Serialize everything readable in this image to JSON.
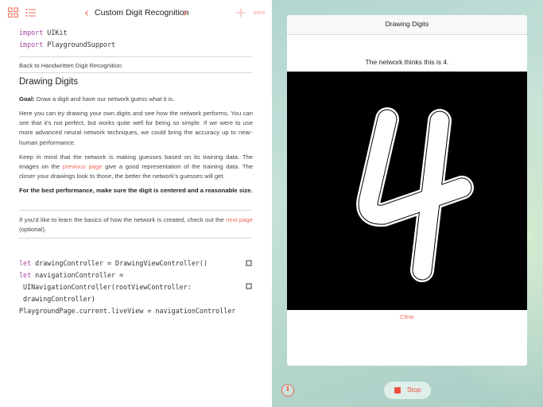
{
  "toolbar": {
    "title": "Custom Digit Recognition",
    "prev_chevron": "‹",
    "next_chevron": "›",
    "icons": [
      "grid-icon",
      "list-icon",
      "add-icon",
      "more-icon"
    ]
  },
  "code_top": [
    {
      "keyword": "import",
      "rest": " UIKit"
    },
    {
      "keyword": "import",
      "rest": " PlaygroundSupport"
    }
  ],
  "back_link": "Back to Handwritten Digit Recognition",
  "heading": "Drawing Digits",
  "goal": {
    "label": "Goal:",
    "text": " Draw a digit and have our network guess what it is."
  },
  "para1": "Here you can try drawing your own digits and see how the network performs. You can see that it's not perfect, but works quite well for being so simple. If we were to use more advanced neural network techniques, we could bring the accuracy up to near-human performance.",
  "para2": {
    "before": "Keep in mind that the network is making guesses based on its training data. The images on the ",
    "link": "previous page",
    "after": " give a good representation of the training data. The closer your drawings look to those, the better the network's guesses will get."
  },
  "para3": "For the best performance, make sure the digit is centered and a reasonable size.",
  "para4": {
    "before": "If you'd like to learn the basics of how the network is created, check out the ",
    "link": "next page",
    "after": " (optional)."
  },
  "code_bottom": {
    "line1_kw": "let",
    "line1_rest": " drawingController = DrawingViewController()",
    "line2_kw": "let",
    "line2_rest": " navigationController =",
    "line3": "UINavigationController(rootViewController:",
    "line4": "drawingController)",
    "line5": "PlaygroundPage.current.liveView = navigationController"
  },
  "live_view": {
    "nav_title": "Drawing Digits",
    "guess_text": "The network thinks this is 4.",
    "clear_label": "Clear",
    "stop_label": "Stop"
  },
  "colors": {
    "accent": "#ef6a5a",
    "keyword": "#a5479f",
    "stop": "#ef4f43",
    "canvas": "#000000"
  }
}
